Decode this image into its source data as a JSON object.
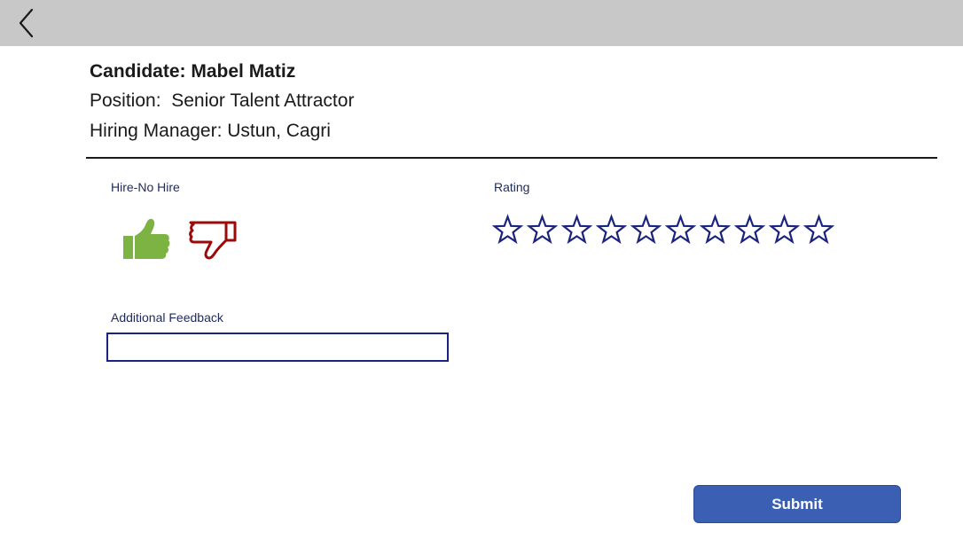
{
  "header": {
    "back_icon": "chevron-left-icon"
  },
  "candidate": {
    "name_line": "Candidate: Mabel Matiz",
    "position_line": "Position:  Senior Talent Attractor",
    "manager_line": "Hiring Manager: Ustun, Cagri"
  },
  "form": {
    "hire_label": "Hire-No Hire",
    "hire_options": [
      {
        "icon": "thumbs-up-icon",
        "color": "#7cb342",
        "style": "filled"
      },
      {
        "icon": "thumbs-down-icon",
        "color": "#9b0a0a",
        "style": "outline"
      }
    ],
    "rating_label": "Rating",
    "rating": {
      "max": 10,
      "value": 0,
      "star_color": "#1a237e"
    },
    "feedback_label": "Additional Feedback",
    "feedback_value": "",
    "submit_label": "Submit"
  },
  "colors": {
    "topbar": "#c8c8c8",
    "accent": "#3b5fb3",
    "label": "#1f2a5a"
  }
}
